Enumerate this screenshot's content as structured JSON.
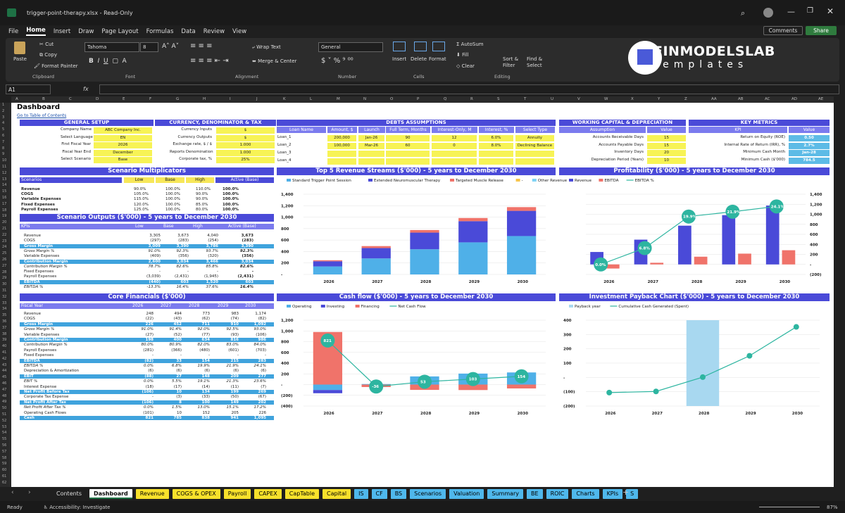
{
  "window": {
    "title": "trigger-point-therapy.xlsx",
    "mode": "Read-Only"
  },
  "menu": [
    "File",
    "Home",
    "Insert",
    "Draw",
    "Page Layout",
    "Formulas",
    "Data",
    "Review",
    "View"
  ],
  "actions": {
    "comments": "Comments",
    "share": "Share"
  },
  "ribbon": {
    "paste": "Paste",
    "cut": "Cut",
    "copy": "Copy",
    "format_painter": "Format Painter",
    "clipboard": "Clipboard",
    "font_name": "Tahoma",
    "font_size": "8",
    "font": "Font",
    "wrap": "Wrap Text",
    "merge": "Merge & Center",
    "alignment": "Alignment",
    "num_fmt": "General",
    "number": "Number",
    "insert": "Insert",
    "delete": "Delete",
    "format": "Format",
    "cells": "Cells",
    "autosum": "AutoSum",
    "fill": "Fill",
    "clear": "Clear",
    "sort": "Sort & Filter",
    "find": "Find & Select",
    "editing": "Editing"
  },
  "brand": {
    "name": "FINMODELSLAB",
    "sub": "Templates"
  },
  "formula": {
    "cell": "A1",
    "fx": "fx"
  },
  "columns": [
    "A",
    "B",
    "C",
    "D",
    "E",
    "F",
    "G",
    "H",
    "I",
    "J",
    "K",
    "L",
    "M",
    "N",
    "O",
    "P",
    "Q",
    "R",
    "S",
    "T",
    "U",
    "V",
    "W",
    "X",
    "Y",
    "Z",
    "AA",
    "AB",
    "AC",
    "AD",
    "AE"
  ],
  "dash": {
    "title": "Dashboard",
    "toc": "Go to Table of Contents"
  },
  "general": {
    "title": "GENERAL SETUP",
    "rows": [
      [
        "Company Name",
        "ABC Company Inc."
      ],
      [
        "Select Language",
        "EN"
      ],
      [
        "First Fiscal Year",
        "2026"
      ],
      [
        "Fiscal Year End",
        "December"
      ],
      [
        "Select Scenario",
        "Base"
      ]
    ]
  },
  "currency": {
    "title": "CURRENCY, DENOMINATOR & TAX",
    "rows": [
      [
        "Currency Inputs",
        "$"
      ],
      [
        "Currency Outputs",
        "$"
      ],
      [
        "Exchange rate, $ / $",
        "1.000"
      ],
      [
        "Reports Denomination",
        "1.000"
      ],
      [
        "Corporate tax, %",
        "25%"
      ]
    ]
  },
  "debts": {
    "title": "DEBTS ASSUMPTIONS",
    "headers": [
      "Loan Name",
      "Amount, $",
      "Launch",
      "Full Term, Months",
      "Interest-Only, M",
      "Interest, %",
      "Select Type"
    ],
    "rows": [
      [
        "Loan_1",
        "200,000",
        "Jan-26",
        "90",
        "12",
        "6.0%",
        "Annuity"
      ],
      [
        "Loan_2",
        "100,000",
        "Mar-26",
        "60",
        "0",
        "8.0%",
        "Declining Balance"
      ],
      [
        "Loan_3",
        "",
        "",
        "",
        "",
        "",
        ""
      ],
      [
        "Loan_4",
        "",
        "",
        "",
        "",
        "",
        ""
      ]
    ]
  },
  "wc": {
    "title": "WORKING CAPITAL & DEPRECIATION",
    "headers": [
      "Assumption",
      "Value"
    ],
    "rows": [
      [
        "Accounts Receivable Days",
        "15"
      ],
      [
        "Accounts Payable Days",
        "15"
      ],
      [
        "Inventory Days",
        "20"
      ],
      [
        "Depreciation Period (Years)",
        "10"
      ]
    ]
  },
  "kpi": {
    "title": "KEY METRICS",
    "headers": [
      "KPI",
      "Value"
    ],
    "rows": [
      [
        "Return on Equity (ROE)",
        "0.50"
      ],
      [
        "Internal Rate of Return (IRR), %",
        "2.7%"
      ],
      [
        "Minimum Cash Month",
        "Jan-28"
      ],
      [
        "Minimum Cash ($'000)",
        "784.5"
      ]
    ]
  },
  "scen": {
    "title": "Scenario Multiplicators",
    "headers": [
      "Scenarios",
      "Low",
      "Base",
      "High",
      "Active (Base)"
    ],
    "rows": [
      [
        "Revenue",
        "90.0%",
        "100.0%",
        "110.0%",
        "100.0%"
      ],
      [
        "COGS",
        "105.0%",
        "100.0%",
        "90.0%",
        "100.0%"
      ],
      [
        "Variable Expenses",
        "115.0%",
        "100.0%",
        "90.0%",
        "100.0%"
      ],
      [
        "Fixed Expenses",
        "120.0%",
        "100.0%",
        "85.0%",
        "100.0%"
      ],
      [
        "Payroll Expenses",
        "125.0%",
        "100.0%",
        "80.0%",
        "100.0%"
      ]
    ]
  },
  "outputs": {
    "title": "Scenario Outputs ($'000) - 5 years to December 2030",
    "headers": [
      "KPIs",
      "Low",
      "Base",
      "High",
      "Active (Base)"
    ],
    "rows": [
      [
        "Revenue",
        "3,305",
        "3,673",
        "4,040",
        "3,673"
      ],
      [
        "COGS",
        "(297)",
        "(283)",
        "(254)",
        "(283)"
      ],
      [
        "Gross Margin",
        "3,009",
        "3,390",
        "3,786",
        "3,390"
      ],
      [
        "Gross Margin %",
        "91.0%",
        "92.3%",
        "93.7%",
        "92.3%"
      ],
      [
        "Variable Expenses",
        "(409)",
        "(356)",
        "(320)",
        "(356)"
      ],
      [
        "Contribution Margin",
        "2,600",
        "3,034",
        "3,466",
        "3,034"
      ],
      [
        "Contribution Margin %",
        "78.7%",
        "82.6%",
        "85.8%",
        "82.6%"
      ],
      [
        "Fixed Expenses",
        "-",
        "-",
        "-",
        "-"
      ],
      [
        "Payroll Expenses",
        "(3,039)",
        "(2,431)",
        "(1,945)",
        "(2,431)"
      ],
      [
        "EBITDA",
        "(440)",
        "603",
        "1,520",
        "603"
      ],
      [
        "EBITDA %",
        "-13.3%",
        "16.4%",
        "37.6%",
        "16.4%"
      ]
    ]
  },
  "core": {
    "title": "Core Financials ($'000)",
    "headers": [
      "Fiscal Year",
      "2026",
      "2027",
      "2028",
      "2029",
      "2030"
    ],
    "rows": [
      [
        "Revenue",
        "248",
        "494",
        "773",
        "983",
        "1,174"
      ],
      [
        "COGS",
        "(22)",
        "(43)",
        "(62)",
        "(74)",
        "(82)"
      ],
      [
        "Gross Margin",
        "226",
        "452",
        "711",
        "910",
        "1,092"
      ],
      [
        "Gross Margin %",
        "91.0%",
        "91.4%",
        "92.0%",
        "92.5%",
        "93.0%"
      ],
      [
        "Variable Expenses",
        "(27)",
        "(52)",
        "(77)",
        "(93)",
        "(106)"
      ],
      [
        "Contribution Margin",
        "198",
        "400",
        "634",
        "816",
        "986"
      ],
      [
        "Contribution Margin %",
        "80.0%",
        "80.9%",
        "82.0%",
        "83.0%",
        "84.0%"
      ],
      [
        "Payroll Expenses",
        "(281)",
        "(366)",
        "(480)",
        "(601)",
        "(703)"
      ],
      [
        "Fixed Expenses",
        "-",
        "-",
        "-",
        "-",
        "-"
      ],
      [
        "EBITDA",
        "(82)",
        "33",
        "154",
        "215",
        "283"
      ],
      [
        "EBITDA %",
        "0.0%",
        "6.8%",
        "19.9%",
        "21.9%",
        "24.1%"
      ],
      [
        "Depreciation & Amortization",
        "(6)",
        "(6)",
        "(6)",
        "(6)",
        "(6)"
      ],
      [
        "EBIT",
        "(88)",
        "27",
        "148",
        "209",
        "277"
      ],
      [
        "EBIT %",
        "0.0%",
        "5.5%",
        "19.1%",
        "21.3%",
        "23.6%"
      ],
      [
        "Interest Expense",
        "(18)",
        "(17)",
        "(14)",
        "(11)",
        "(7)"
      ],
      [
        "Net Profit Before Tax",
        "(106)",
        "10",
        "134",
        "199",
        "269"
      ],
      [
        "Corporate Tax Expense",
        "-",
        "(3)",
        "(33)",
        "(50)",
        "(67)"
      ],
      [
        "Net Profit After Tax",
        "(106)",
        "8",
        "100",
        "149",
        "202"
      ],
      [
        "Net Profit After Tax %",
        "0.0%",
        "1.5%",
        "13.0%",
        "15.1%",
        "17.2%"
      ],
      [
        "Operating Cash Flows",
        "(101)",
        "10",
        "152",
        "205",
        "226"
      ],
      [
        "Cash",
        "821",
        "785",
        "838",
        "941",
        "1,095"
      ]
    ]
  },
  "chart_data": [
    {
      "type": "bar",
      "title": "Top 5 Revenue Streams ($'000) - 5 years to December 2030",
      "categories": [
        "2026",
        "2027",
        "2028",
        "2029",
        "2030"
      ],
      "ylim": [
        0,
        1400
      ],
      "yticks": [
        "1,400",
        "1,200",
        "1,000",
        "800",
        "600",
        "400",
        "200",
        "-"
      ],
      "series": [
        {
          "name": "Standard Trigger Point Session",
          "color": "#4fb0e8",
          "values": [
            140,
            280,
            440,
            560,
            670
          ]
        },
        {
          "name": "Extended Neuromuscular Therapy",
          "color": "#4a4ad8",
          "values": [
            90,
            180,
            290,
            370,
            440
          ]
        },
        {
          "name": "Targeted Muscle Release",
          "color": "#f0736a",
          "values": [
            18,
            35,
            45,
            55,
            65
          ]
        },
        {
          "name": "-",
          "color": "#f7c44a",
          "values": [
            0,
            0,
            0,
            0,
            0
          ]
        },
        {
          "name": "Other Revenue",
          "color": "#7fd3f5",
          "values": [
            0,
            0,
            0,
            0,
            0
          ]
        }
      ]
    },
    {
      "type": "bar",
      "title": "Profitability ($'000) - 5 years to December 2030",
      "categories": [
        "2026",
        "2027",
        "2028",
        "2029",
        "2030"
      ],
      "ylim": [
        -200,
        1400
      ],
      "yticks": [
        "1,400",
        "1,200",
        "1,000",
        "800",
        "600",
        "400",
        "200",
        "-",
        "(200)"
      ],
      "series": [
        {
          "name": "Revenue",
          "color": "#4a4ad8",
          "values": [
            248,
            494,
            773,
            983,
            1174
          ]
        },
        {
          "name": "EBITDA",
          "color": "#f0736a",
          "values": [
            -82,
            33,
            154,
            215,
            283
          ]
        },
        {
          "name": "EBITDA %",
          "color": "#2db5a0",
          "values": [
            0.0,
            6.8,
            19.9,
            21.9,
            24.1
          ],
          "labels": [
            "0.0%",
            "6.8%",
            "19.9%",
            "21.9%",
            "24.1%"
          ]
        }
      ]
    },
    {
      "type": "bar",
      "title": "Cash flow ($'000) - 5 years to December 2030",
      "categories": [
        "2026",
        "2027",
        "2028",
        "2029",
        "2030"
      ],
      "ylim": [
        -400,
        1200
      ],
      "yticks": [
        "1,200",
        "1,000",
        "800",
        "600",
        "400",
        "200",
        "-",
        "(200)",
        "(400)"
      ],
      "series": [
        {
          "name": "Operating",
          "color": "#4fb0e8",
          "values": [
            -101,
            10,
            152,
            205,
            226
          ]
        },
        {
          "name": "Investing",
          "color": "#4a4ad8",
          "values": [
            -60,
            0,
            0,
            0,
            0
          ]
        },
        {
          "name": "Financing",
          "color": "#f0736a",
          "values": [
            980,
            -46,
            -99,
            -102,
            -72
          ]
        },
        {
          "name": "Net Cash Flow",
          "color": "#2db5a0",
          "values": [
            821,
            -36,
            53,
            103,
            154
          ]
        }
      ]
    },
    {
      "type": "bar",
      "title": "Investment Payback Chart ($'000) - 5 years to December 2030",
      "categories": [
        "2026",
        "2027",
        "2028",
        "2029",
        "2030"
      ],
      "ylim": [
        -200,
        400
      ],
      "yticks": [
        "400",
        "300",
        "200",
        "100",
        "-",
        "(100)",
        "(200)"
      ],
      "series": [
        {
          "name": "Payback year",
          "color": "#a8d8f0",
          "values": [
            0,
            0,
            1,
            0,
            0
          ]
        },
        {
          "name": "Cumulative Cash Generated (Spent)",
          "color": "#2db5a0",
          "values": [
            -106,
            -98,
            2,
            151,
            353
          ]
        }
      ]
    }
  ],
  "tabs": [
    {
      "n": "Contents",
      "c": "#1f1f1f",
      "f": "#ddd"
    },
    {
      "n": "Dashboard",
      "c": "#ffffff",
      "f": "#000"
    },
    {
      "n": "Revenue",
      "c": "#f7e12b",
      "f": "#000"
    },
    {
      "n": "COGS & OPEX",
      "c": "#f7e12b",
      "f": "#000"
    },
    {
      "n": "Payroll",
      "c": "#f7e12b",
      "f": "#000"
    },
    {
      "n": "CAPEX",
      "c": "#f7e12b",
      "f": "#000"
    },
    {
      "n": "CapTable",
      "c": "#f7e12b",
      "f": "#000"
    },
    {
      "n": "Capital",
      "c": "#f7e12b",
      "f": "#000"
    },
    {
      "n": "IS",
      "c": "#4fb8ec",
      "f": "#000"
    },
    {
      "n": "CF",
      "c": "#4fb8ec",
      "f": "#000"
    },
    {
      "n": "BS",
      "c": "#4fb8ec",
      "f": "#000"
    },
    {
      "n": "Scenarios",
      "c": "#4fb8ec",
      "f": "#000"
    },
    {
      "n": "Valuation",
      "c": "#4fb8ec",
      "f": "#000"
    },
    {
      "n": "Summary",
      "c": "#4fb8ec",
      "f": "#000"
    },
    {
      "n": "BE",
      "c": "#4fb8ec",
      "f": "#000"
    },
    {
      "n": "ROIC",
      "c": "#4fb8ec",
      "f": "#000"
    },
    {
      "n": "Charts",
      "c": "#4fb8ec",
      "f": "#000"
    },
    {
      "n": "KPIs",
      "c": "#4fb8ec",
      "f": "#000"
    },
    {
      "n": "S",
      "c": "#4fb8ec",
      "f": "#000"
    }
  ],
  "status": {
    "ready": "Ready",
    "access": "Accessibility: Investigate",
    "zoom": "87%"
  }
}
